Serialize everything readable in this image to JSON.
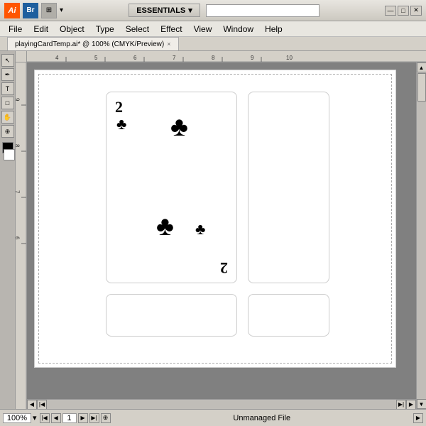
{
  "titlebar": {
    "essentials_label": "ESSENTIALS",
    "dropdown_arrow": "▾",
    "min_btn": "—",
    "max_btn": "□",
    "close_btn": "✕"
  },
  "menubar": {
    "items": [
      "File",
      "Edit",
      "Object",
      "Type",
      "Select",
      "Effect",
      "View",
      "Window",
      "Help"
    ]
  },
  "tab": {
    "label": "playingCardTemp.ai* @ 100% (CMYK/Preview)",
    "close": "×"
  },
  "canvas": {
    "zoom": "100%",
    "page": "1",
    "status_file": "Unmanaged File"
  },
  "card": {
    "number": "2",
    "suit": "♣",
    "number_rotated": "2"
  },
  "ruler": {
    "labels": [
      "4",
      "5",
      "6",
      "7",
      "8",
      "9",
      "10"
    ],
    "left_labels": [
      "9",
      "8",
      "7",
      "6"
    ]
  }
}
